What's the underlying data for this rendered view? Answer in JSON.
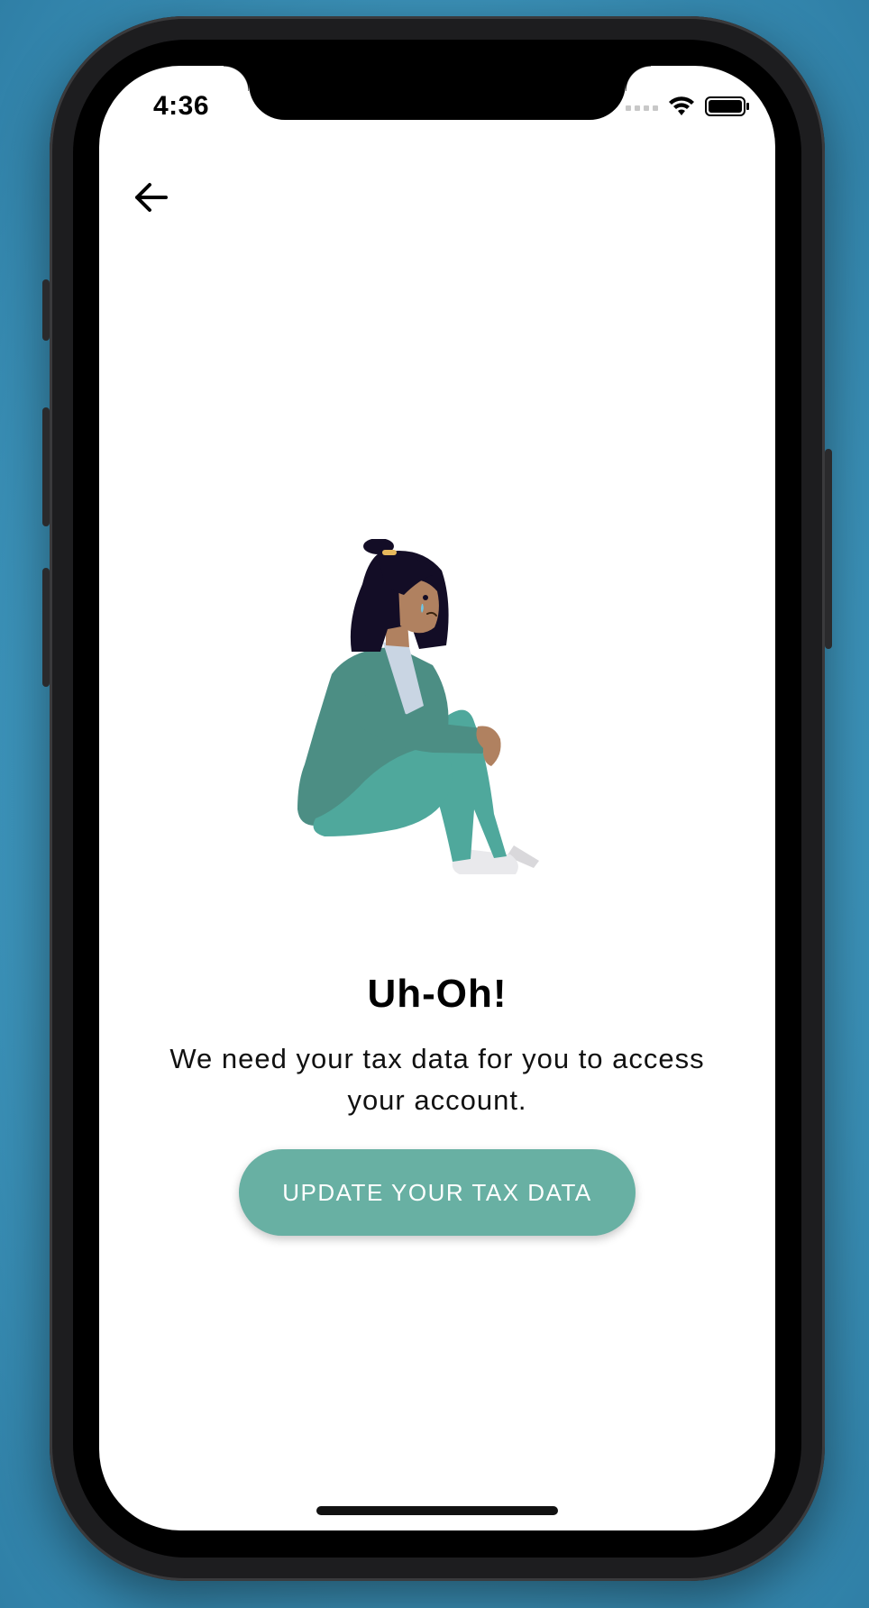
{
  "status_bar": {
    "time": "4:36"
  },
  "navigation": {
    "back_icon": "arrow-left-icon"
  },
  "illustration": {
    "name": "sad-woman-sitting-illustration",
    "colors": {
      "outfit": "#4fa89c",
      "jacket": "#4c8e84",
      "hair": "#130d26",
      "skin": "#b08160"
    }
  },
  "content": {
    "title": "Uh-Oh!",
    "message": "We need your tax data for you to access your account."
  },
  "actions": {
    "update_button_label": "UPDATE YOUR TAX DATA",
    "accent_color": "#68b0a3"
  }
}
